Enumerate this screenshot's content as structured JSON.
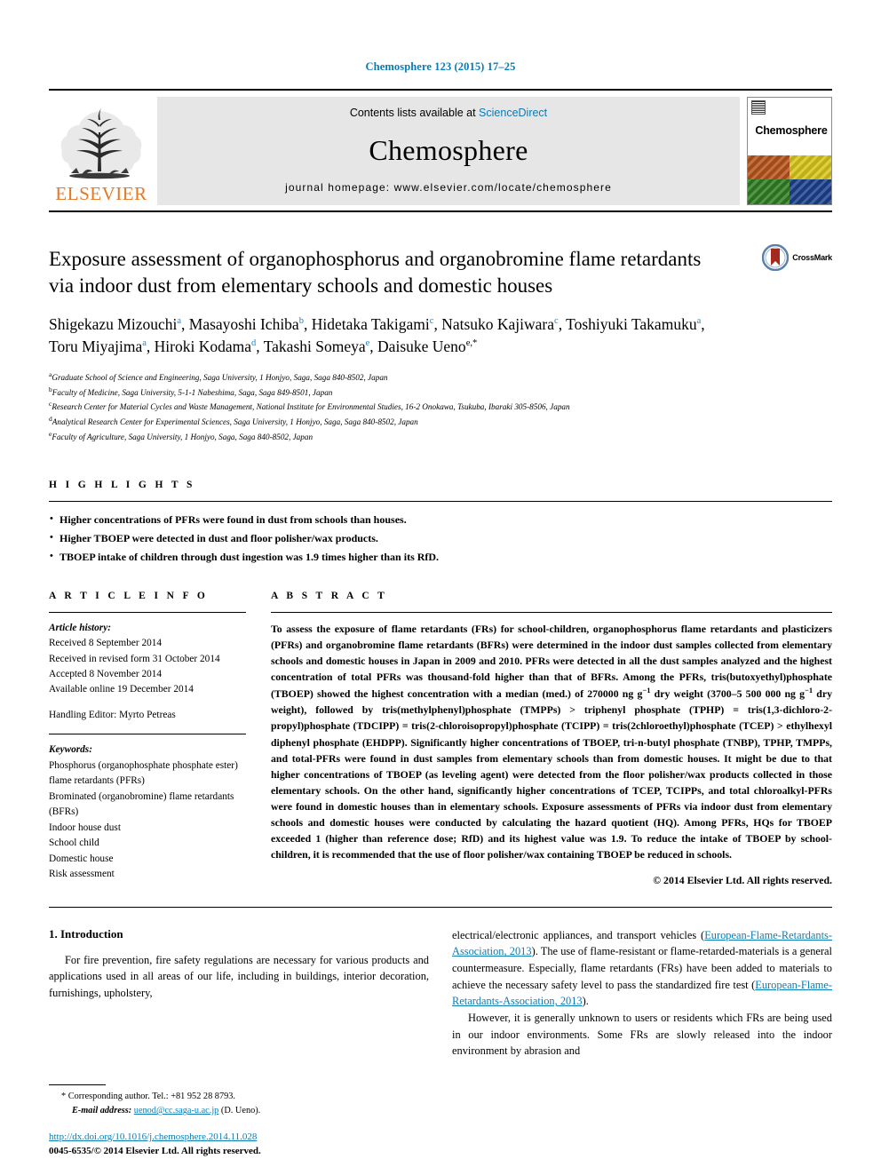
{
  "running_head": "Chemosphere 123 (2015) 17–25",
  "masthead": {
    "contents_prefix": "Contents lists available at ",
    "sciencedirect": "ScienceDirect",
    "journal_name": "Chemosphere",
    "homepage": "journal homepage: www.elsevier.com/locate/chemosphere",
    "publisher": "ELSEVIER",
    "cover_title": "Chemosphere"
  },
  "article": {
    "title": "Exposure assessment of organophosphorus and organobromine flame retardants via indoor dust from elementary schools and domestic houses",
    "crossmark_label": "CrossMark",
    "authors_line1_parts": [
      {
        "name": "Shigekazu Mizouchi",
        "sup": "a"
      },
      {
        "name": "Masayoshi Ichiba",
        "sup": "b"
      },
      {
        "name": "Hidetaka Takigami",
        "sup": "c"
      },
      {
        "name": "Natsuko Kajiwara",
        "sup": "c"
      },
      {
        "name": "Toshiyuki Takamuku",
        "sup": "a"
      }
    ],
    "authors_line2_parts": [
      {
        "name": "Toru Miyajima",
        "sup": "a"
      },
      {
        "name": "Hiroki Kodama",
        "sup": "d"
      },
      {
        "name": "Takashi Someya",
        "sup": "e"
      },
      {
        "name": "Daisuke Ueno",
        "sup": "e,*"
      }
    ],
    "affiliations": [
      {
        "marker": "a",
        "text": "Graduate School of Science and Engineering, Saga University, 1 Honjyo, Saga, Saga 840-8502, Japan"
      },
      {
        "marker": "b",
        "text": "Faculty of Medicine, Saga University, 5-1-1 Nabeshima, Saga, Saga 849-8501, Japan"
      },
      {
        "marker": "c",
        "text": "Research Center for Material Cycles and Waste Management, National Institute for Environmental Studies, 16-2 Onokawa, Tsukuba, Ibaraki 305-8506, Japan"
      },
      {
        "marker": "d",
        "text": "Analytical Research Center for Experimental Sciences, Saga University, 1 Honjyo, Saga, Saga 840-8502, Japan"
      },
      {
        "marker": "e",
        "text": "Faculty of Agriculture, Saga University, 1 Honjyo, Saga, Saga 840-8502, Japan"
      }
    ]
  },
  "highlights": {
    "label": "H I G H L I G H T S",
    "items": [
      "Higher concentrations of PFRs were found in dust from schools than houses.",
      "Higher TBOEP were detected in dust and floor polisher/wax products.",
      "TBOEP intake of children through dust ingestion was 1.9 times higher than its RfD."
    ]
  },
  "article_info": {
    "label": "A R T I C L E   I N F O",
    "history_head": "Article history:",
    "history": [
      "Received 8 September 2014",
      "Received in revised form 31 October 2014",
      "Accepted 8 November 2014",
      "Available online 19 December 2014"
    ],
    "handling_editor": "Handling Editor: Myrto Petreas",
    "keywords_head": "Keywords:",
    "keywords": [
      "Phosphorus (organophosphate phosphate ester) flame retardants (PFRs)",
      "Brominated (organobromine) flame retardants (BFRs)",
      "Indoor house dust",
      "School child",
      "Domestic house",
      "Risk assessment"
    ]
  },
  "abstract": {
    "label": "A B S T R A C T",
    "text_part1": "To assess the exposure of flame retardants (FRs) for school-children, organophosphorus flame retardants and plasticizers (PFRs) and organobromine flame retardants (BFRs) were determined in the indoor dust samples collected from elementary schools and domestic houses in Japan in 2009 and 2010. PFRs were detected in all the dust samples analyzed and the highest concentration of total PFRs was thousand-fold higher than that of BFRs. Among the PFRs, tris(butoxyethyl)phosphate (TBOEP) showed the highest concentration with a median (med.) of 270000 ng g",
    "sup1": "−1",
    "text_part2": " dry weight (3700–5 500 000 ng g",
    "sup2": "−1",
    "text_part3": " dry weight), followed by tris(methylphenyl)phosphate (TMPPs) > triphenyl phosphate (TPHP) = tris(1,3-dichloro-2-propyl)phosphate (TDCIPP) = tris(2-chloroisopropyl)phosphate (TCIPP) = tris(2chloroethyl)phosphate (TCEP) > ethylhexyl diphenyl phosphate (EHDPP). Significantly higher concentrations of TBOEP, tri-n-butyl phosphate (TNBP), TPHP, TMPPs, and total-PFRs were found in dust samples from elementary schools than from domestic houses. It might be due to that higher concentrations of TBOEP (as leveling agent) were detected from the floor polisher/wax products collected in those elementary schools. On the other hand, significantly higher concentrations of TCEP, TCIPPs, and total chloroalkyl-PFRs were found in domestic houses than in elementary schools. Exposure assessments of PFRs via indoor dust from elementary schools and domestic houses were conducted by calculating the hazard quotient (HQ). Among PFRs, HQs for TBOEP exceeded 1 (higher than reference dose; RfD) and its highest value was 1.9. To reduce the intake of TBOEP by school-children, it is recommended that the use of floor polisher/wax containing TBOEP be reduced in schools.",
    "copyright": "© 2014 Elsevier Ltd. All rights reserved."
  },
  "introduction": {
    "heading": "1. Introduction",
    "left_para": "For fire prevention, fire safety regulations are necessary for various products and applications used in all areas of our life, including in buildings, interior decoration, furnishings, upholstery,",
    "right_para1_a": "electrical/electronic appliances, and transport vehicles (",
    "right_para1_cite1": "European-Flame-Retardants-Association, 2013",
    "right_para1_b": "). The use of flame-resistant or flame-retarded-materials is a general countermeasure. Especially, flame retardants (FRs) have been added to materials to achieve the necessary safety level to pass the standardized fire test (",
    "right_para1_cite2": "European-Flame-Retardants-Association, 2013",
    "right_para1_c": ").",
    "right_para2": "However, it is generally unknown to users or residents which FRs are being used in our indoor environments. Some FRs are slowly released into the indoor environment by abrasion and"
  },
  "footnote": {
    "star": "*",
    "corresponding": "Corresponding author. Tel.: +81 952 28 8793.",
    "email_label": "E-mail address:",
    "email": "uenod@cc.saga-u.ac.jp",
    "email_suffix": "(D. Ueno).",
    "doi": "http://dx.doi.org/10.1016/j.chemosphere.2014.11.028",
    "issn": "0045-6535/© 2014 Elsevier Ltd. All rights reserved."
  },
  "colors": {
    "link": "#0b7bb5",
    "elsevier_orange": "#E87722",
    "masthead_gray": "#e6e6e6"
  }
}
